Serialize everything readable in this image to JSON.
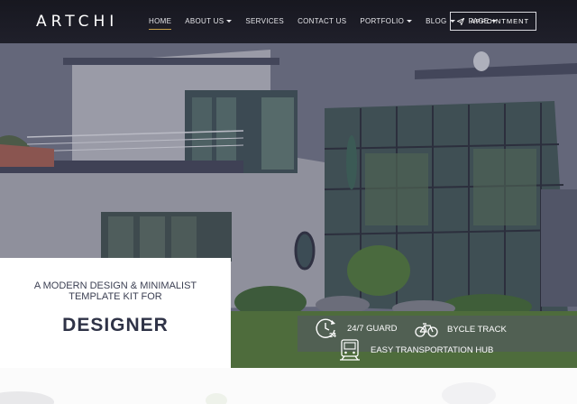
{
  "brand": {
    "logo": "ARTCHI"
  },
  "nav": {
    "items": [
      {
        "label": "HOME",
        "has_dropdown": false,
        "active": true
      },
      {
        "label": "ABOUT US",
        "has_dropdown": true,
        "active": false
      },
      {
        "label": "SERVICES",
        "has_dropdown": false,
        "active": false
      },
      {
        "label": "CONTACT US",
        "has_dropdown": false,
        "active": false
      },
      {
        "label": "PORTFOLIO",
        "has_dropdown": true,
        "active": false
      },
      {
        "label": "BLOG",
        "has_dropdown": true,
        "active": false
      },
      {
        "label": "PAGE",
        "has_dropdown": true,
        "active": false
      }
    ],
    "cta_label": "APPOINTMENT",
    "cta_icon": "paper-plane-icon"
  },
  "hero": {
    "tagline": "A MODERN DESIGN & MINIMALIST TEMPLATE KIT FOR",
    "headline": "DESIGNER",
    "features": [
      {
        "icon": "clock-24-icon",
        "label": "24/7 GUARD"
      },
      {
        "icon": "bicycle-icon",
        "label": "BYCLE TRACK"
      },
      {
        "icon": "train-icon",
        "label": "EASY TRANSPORTATION HUB"
      }
    ]
  },
  "colors": {
    "nav_bg": "#17171f",
    "active_underline": "#c9a24a",
    "headline_text": "#2f3347",
    "hero_overlay": "#5c5f75"
  }
}
